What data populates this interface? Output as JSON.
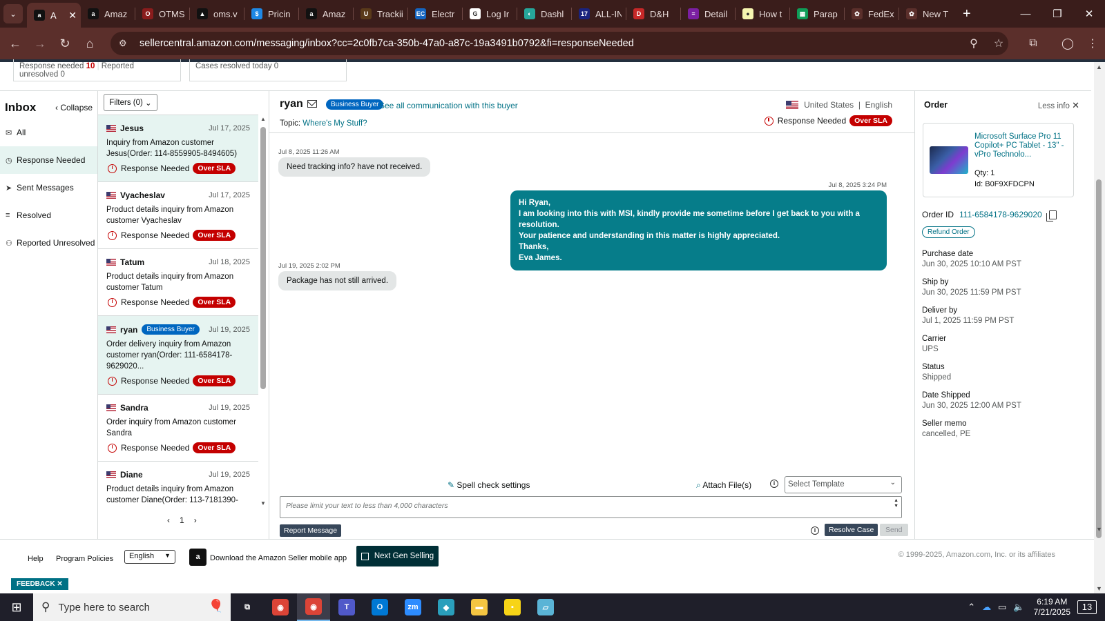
{
  "browser": {
    "tabs": [
      {
        "label": "A",
        "favicon": "amazon-icon",
        "color": "#111111",
        "glyph": "a",
        "active": true
      },
      {
        "label": "Amaz",
        "favicon": "amazon-icon",
        "color": "#111111",
        "glyph": "a"
      },
      {
        "label": "OTMS",
        "favicon": "otms-icon",
        "color": "#8a1c1c",
        "glyph": "O"
      },
      {
        "label": "oms.v",
        "favicon": "oms-icon",
        "color": "#111111",
        "glyph": "▲"
      },
      {
        "label": "Pricin",
        "favicon": "pricing-icon",
        "color": "#1e88e5",
        "glyph": "$"
      },
      {
        "label": "Amaz",
        "favicon": "amazon-icon",
        "color": "#111111",
        "glyph": "a"
      },
      {
        "label": "Trackii",
        "favicon": "ups-icon",
        "color": "#5a3a1a",
        "glyph": "U"
      },
      {
        "label": "Electr",
        "favicon": "ec-icon",
        "color": "#1565c0",
        "glyph": "EC"
      },
      {
        "label": "Log Ir",
        "favicon": "google-icon",
        "color": "#ffffff",
        "glyph": "G"
      },
      {
        "label": "Dashl",
        "favicon": "dashboard-icon",
        "color": "#26a69a",
        "glyph": "◐"
      },
      {
        "label": "ALL-IN",
        "favicon": "allin-icon",
        "color": "#1a237e",
        "glyph": "17"
      },
      {
        "label": "D&H",
        "favicon": "dh-icon",
        "color": "#c62828",
        "glyph": "D"
      },
      {
        "label": "Detail",
        "favicon": "detail-icon",
        "color": "#7b1fa2",
        "glyph": "≡"
      },
      {
        "label": "How t",
        "favicon": "howto-icon",
        "color": "#f5f5b0",
        "glyph": "●"
      },
      {
        "label": "Parap",
        "favicon": "sheets-icon",
        "color": "#0f9d58",
        "glyph": "▦"
      },
      {
        "label": "FedEx",
        "favicon": "chatgpt-icon",
        "color": "#5b2f2b",
        "glyph": "✿"
      },
      {
        "label": "New T",
        "favicon": "chatgpt-icon",
        "color": "#5b2f2b",
        "glyph": "✿"
      }
    ],
    "url": "sellercentral.amazon.com/messaging/inbox?cc=2c0fb7ca-350b-47a0-a87c-19a3491b0792&fi=responseNeeded"
  },
  "stats": {
    "response_needed_label": "Response needed",
    "response_needed_count": "10",
    "reported_unresolved_label": "Reported unresolved",
    "reported_unresolved_count": "0",
    "cases_resolved_label": "Cases resolved today 0"
  },
  "inbox": {
    "title": "Inbox",
    "collapse": "Collapse",
    "filters": "Filters (0)",
    "nav": [
      {
        "label": "All",
        "icon": "mail-icon"
      },
      {
        "label": "Response Needed",
        "icon": "clock-icon",
        "selected": true
      },
      {
        "label": "Sent Messages",
        "icon": "send-icon"
      },
      {
        "label": "Resolved",
        "icon": "resolved-icon"
      },
      {
        "label": "Reported Unresolved",
        "icon": "report-user-icon"
      }
    ],
    "messages": [
      {
        "name": "Jesus",
        "date": "Jul 17, 2025",
        "preview": "Inquiry from Amazon customer Jesus(Order: 114-8559905-8494605)",
        "status": "Response Needed",
        "sla": "Over SLA",
        "selected": true
      },
      {
        "name": "Vyacheslav",
        "date": "Jul 17, 2025",
        "preview": "Product details inquiry from Amazon customer Vyacheslav",
        "status": "Response Needed",
        "sla": "Over SLA"
      },
      {
        "name": "Tatum",
        "date": "Jul 18, 2025",
        "preview": "Product details inquiry from Amazon customer Tatum",
        "status": "Response Needed",
        "sla": "Over SLA"
      },
      {
        "name": "ryan",
        "badge": "Business Buyer",
        "date": "Jul 19, 2025",
        "preview": "Order delivery inquiry from Amazon customer ryan(Order: 111-6584178-9629020...",
        "status": "Response Needed",
        "sla": "Over SLA",
        "selected": true
      },
      {
        "name": "Sandra",
        "date": "Jul 19, 2025",
        "preview": "Order inquiry from Amazon customer Sandra",
        "status": "Response Needed",
        "sla": "Over SLA"
      },
      {
        "name": "Diane",
        "date": "Jul 19, 2025",
        "preview": "Product details inquiry from Amazon customer Diane(Order: 113-7181390-",
        "status": "",
        "sla": ""
      }
    ],
    "page": "1"
  },
  "conversation": {
    "buyer": "ryan",
    "badge": "Business Buyer",
    "see_all": "See all communication with this buyer",
    "topic_label": "Topic:",
    "topic": "Where's My Stuff?",
    "country": "United States",
    "language": "English",
    "status": "Response Needed",
    "sla": "Over SLA",
    "messages": [
      {
        "dir": "in",
        "time": "Jul 8, 2025 11:26 AM",
        "text": "Need tracking info?  have not received."
      },
      {
        "dir": "out",
        "time": "Jul 8, 2025 3:24 PM",
        "lines": [
          "Hi Ryan,",
          "I am looking into this with MSI, kindly provide me sometime before I get back to you with a resolution.",
          "Your patience and understanding in this matter is highly appreciated.",
          "Thanks,",
          "Eva James."
        ]
      },
      {
        "dir": "in",
        "time": "Jul 19, 2025 2:02 PM",
        "text": "Package has not still arrived."
      }
    ],
    "spell_check": "Spell check settings",
    "attach": "Attach File(s)",
    "template_placeholder": "Select Template",
    "compose_placeholder": "Please limit your text to less than 4,000 characters",
    "report": "Report Message",
    "resolve": "Resolve Case",
    "send": "Send"
  },
  "order": {
    "title": "Order",
    "less_info": "Less info",
    "product_title": "Microsoft Surface Pro 11 Copilot+ PC Tablet - 13\" - vPro Technolo...",
    "qty": "Qty: 1",
    "asin": "Id: B0F9XFDCPN",
    "order_id_label": "Order ID",
    "order_id": "111-6584178-9629020",
    "refund": "Refund Order",
    "fields": [
      {
        "label": "Purchase date",
        "value": "Jun 30, 2025 10:10 AM PST"
      },
      {
        "label": "Ship by",
        "value": "Jun 30, 2025 11:59 PM PST"
      },
      {
        "label": "Deliver by",
        "value": "Jul 1, 2025 11:59 PM PST"
      },
      {
        "label": "Carrier",
        "value": "UPS"
      },
      {
        "label": "Status",
        "value": "Shipped"
      },
      {
        "label": "Date Shipped",
        "value": "Jun 30, 2025 12:00 AM PST"
      },
      {
        "label": "Seller memo",
        "value": "cancelled, PE"
      }
    ]
  },
  "footer": {
    "help": "Help",
    "policies": "Program Policies",
    "language": "English",
    "app_link": "Download the Amazon Seller mobile app",
    "next_gen": "Next Gen Selling",
    "copyright": "© 1999-2025, Amazon.com, Inc. or its affiliates",
    "feedback": "FEEDBACK"
  },
  "taskbar": {
    "search_placeholder": "Type here to search",
    "apps": [
      {
        "name": "task-view",
        "color": "#1f1f2a",
        "glyph": "⧉"
      },
      {
        "name": "chrome",
        "color": "#db4437",
        "glyph": "◉"
      },
      {
        "name": "chrome-profile",
        "color": "#db4437",
        "glyph": "◉",
        "active": true
      },
      {
        "name": "teams",
        "color": "#5059c9",
        "glyph": "T"
      },
      {
        "name": "outlook",
        "color": "#0078d4",
        "glyph": "O"
      },
      {
        "name": "zoom",
        "color": "#2d8cff",
        "glyph": "zm"
      },
      {
        "name": "app-diamond",
        "color": "#2a9fbc",
        "glyph": "◆"
      },
      {
        "name": "file-explorer",
        "color": "#f4c542",
        "glyph": "▬"
      },
      {
        "name": "sticky-notes",
        "color": "#f7d417",
        "glyph": "▪"
      },
      {
        "name": "notepad",
        "color": "#5ab4d6",
        "glyph": "▱"
      }
    ],
    "time": "6:19 AM",
    "date": "7/21/2025",
    "notifications": "13"
  }
}
